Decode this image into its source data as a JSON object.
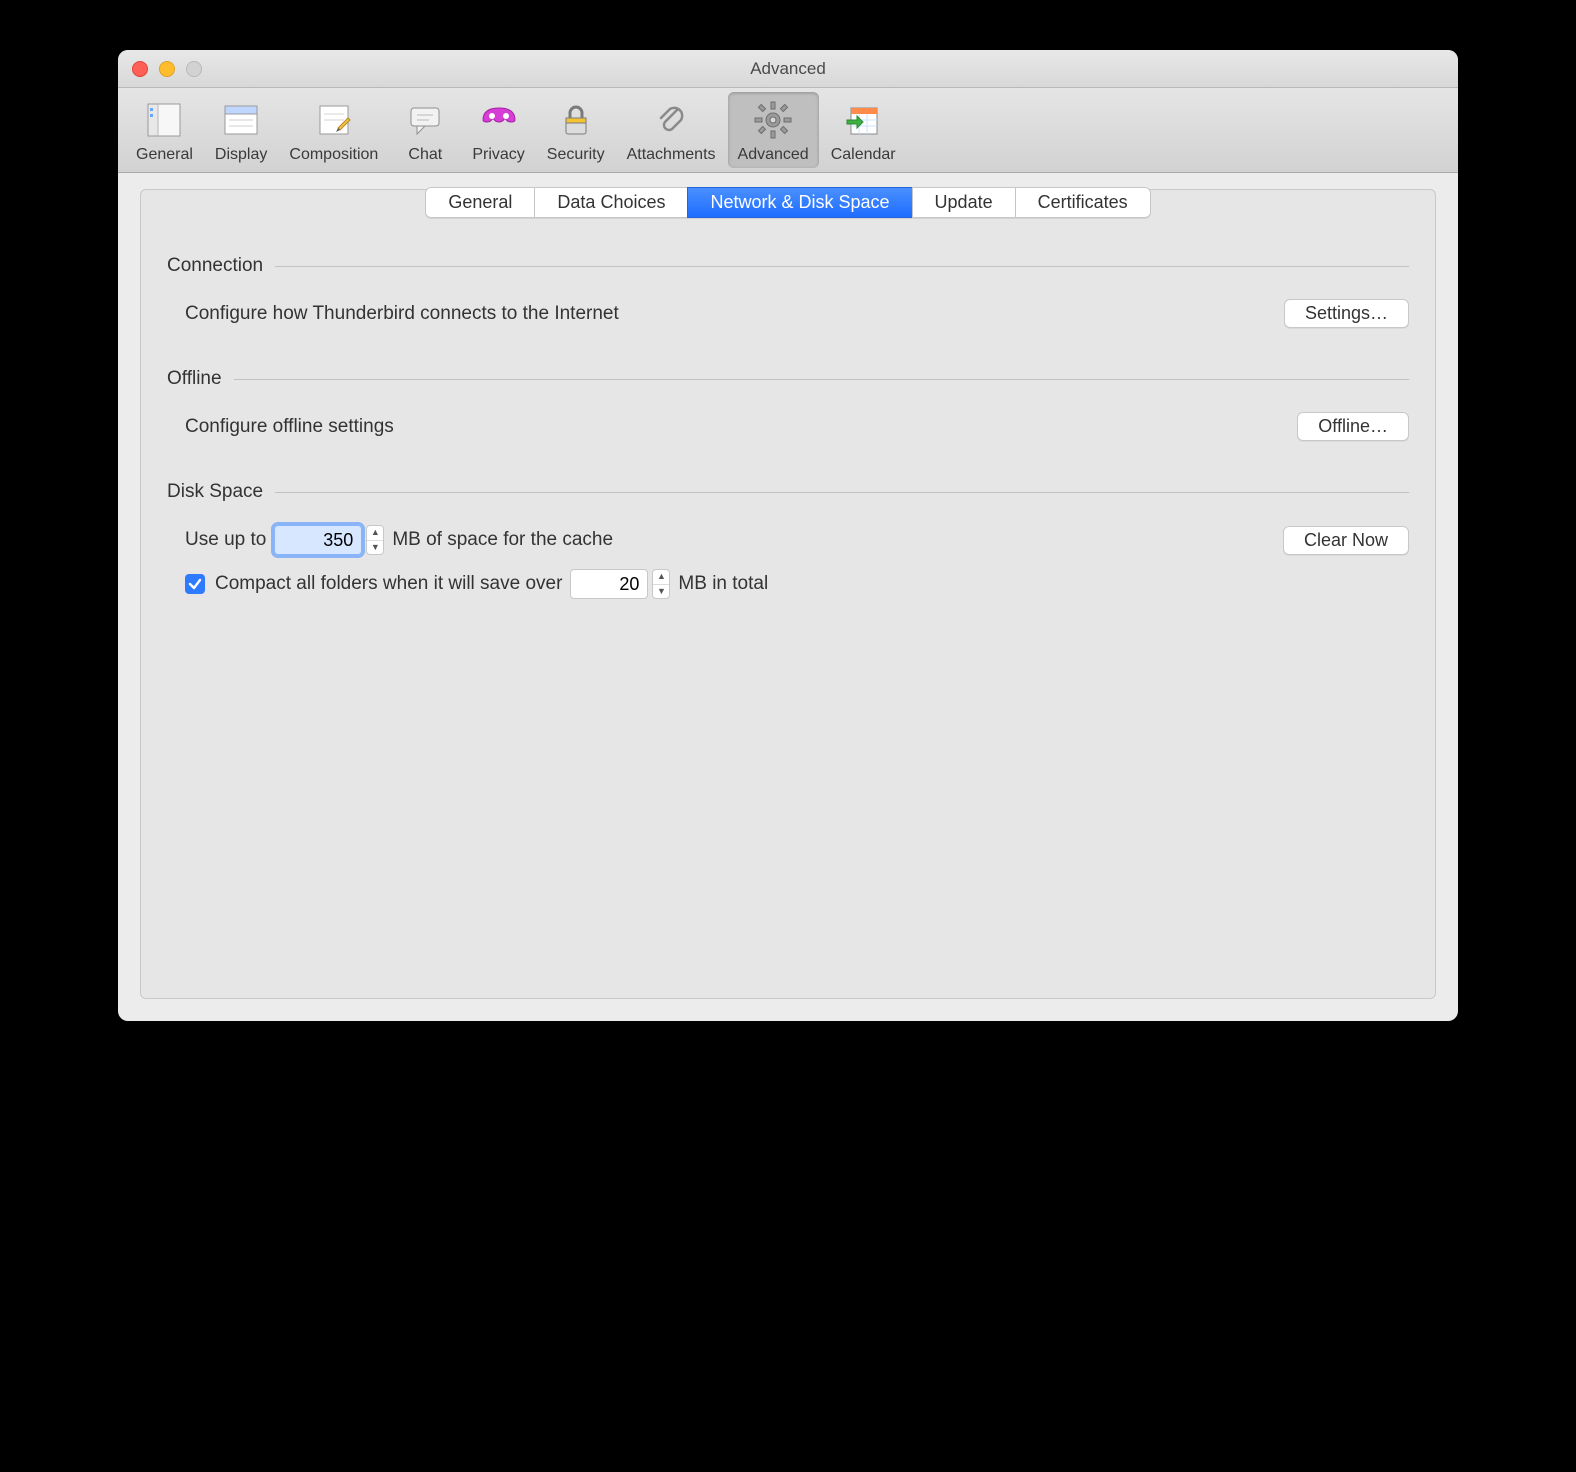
{
  "window": {
    "title": "Advanced"
  },
  "toolbar": {
    "items": [
      {
        "label": "General"
      },
      {
        "label": "Display"
      },
      {
        "label": "Composition"
      },
      {
        "label": "Chat"
      },
      {
        "label": "Privacy"
      },
      {
        "label": "Security"
      },
      {
        "label": "Attachments"
      },
      {
        "label": "Advanced"
      },
      {
        "label": "Calendar"
      }
    ]
  },
  "tabs": {
    "items": [
      {
        "label": "General"
      },
      {
        "label": "Data Choices"
      },
      {
        "label": "Network & Disk Space"
      },
      {
        "label": "Update"
      },
      {
        "label": "Certificates"
      }
    ]
  },
  "sections": {
    "connection": {
      "title": "Connection",
      "desc": "Configure how Thunderbird connects to the Internet",
      "button": "Settings…"
    },
    "offline": {
      "title": "Offline",
      "desc": "Configure offline settings",
      "button": "Offline…"
    },
    "disk": {
      "title": "Disk Space",
      "use_up_to_prefix": "Use up to",
      "cache_value": "350",
      "use_up_to_suffix": "MB of space for the cache",
      "clear_button": "Clear Now",
      "compact_label": "Compact all folders when it will save over",
      "compact_value": "20",
      "compact_suffix": "MB in total",
      "compact_checked": true
    }
  }
}
